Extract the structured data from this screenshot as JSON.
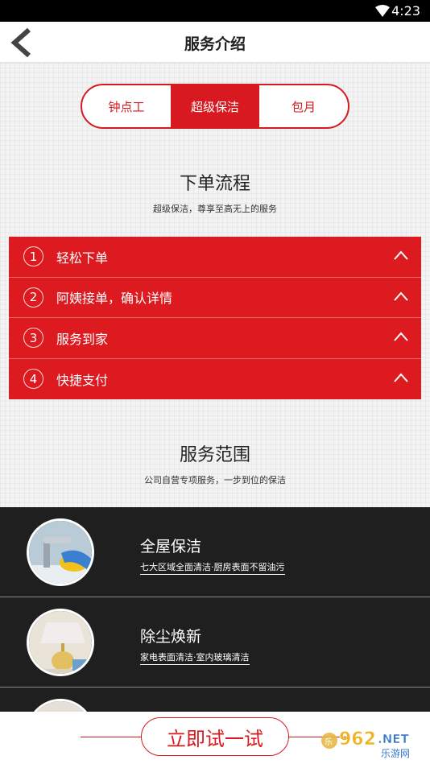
{
  "status_bar": {
    "time": "4:23"
  },
  "header": {
    "title": "服务介绍"
  },
  "tabs": [
    {
      "label": "钟点工",
      "active": false
    },
    {
      "label": "超级保洁",
      "active": true
    },
    {
      "label": "包月",
      "active": false
    }
  ],
  "process": {
    "title": "下单流程",
    "subtitle": "超级保洁，尊享至高无上的服务",
    "steps": [
      {
        "num": "1",
        "label": "轻松下单"
      },
      {
        "num": "2",
        "label": "阿姨接单，确认详情"
      },
      {
        "num": "3",
        "label": "服务到家"
      },
      {
        "num": "4",
        "label": "快捷支付"
      }
    ]
  },
  "scope": {
    "title": "服务范围",
    "subtitle": "公司自营专项服务，一步到位的保洁",
    "items": [
      {
        "name": "全屋保洁",
        "desc": "七大区域全面清洁·厨房表面不留油污"
      },
      {
        "name": "除尘焕新",
        "desc": "家电表面清洁·室内玻璃清洁"
      }
    ]
  },
  "cta": {
    "label": "立即试一试"
  },
  "watermark": {
    "text": "962.NET",
    "sub": "乐游网"
  },
  "colors": {
    "accent": "#d81920",
    "dark": "#1f1f1f"
  }
}
